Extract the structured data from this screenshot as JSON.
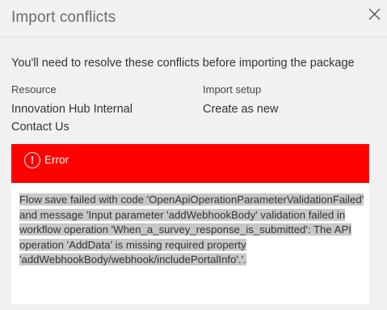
{
  "dialog": {
    "title": "Import conflicts",
    "close_icon": "close-icon",
    "intro": "You'll need to resolve these conflicts before importing the package"
  },
  "columns": {
    "resource_header": "Resource",
    "setup_header": "Import setup",
    "resources": [
      "Innovation Hub Internal",
      "Contact Us"
    ],
    "setups": [
      "Create as new"
    ]
  },
  "error": {
    "icon": "error-circle-icon",
    "icon_glyph": "!",
    "label": "Error",
    "bar_color": "#ff0000",
    "message": "Flow save failed with code 'OpenApiOperationParameterValidationFailed' and message 'Input parameter 'addWebhookBody' validation failed in workflow operation 'When_a_survey_response_is_submitted': The API operation 'AddData' is missing required property 'addWebhookBody/webhook/includePortalInfo'.'."
  }
}
